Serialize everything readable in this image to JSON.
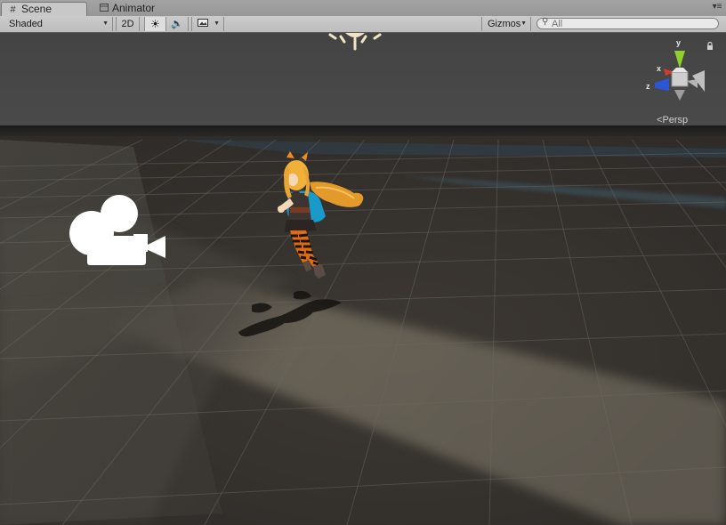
{
  "tabs": [
    {
      "label": "Scene",
      "icon": "grid-icon",
      "active": true
    },
    {
      "label": "Animator",
      "icon": "animator-icon",
      "active": false
    }
  ],
  "toolbar": {
    "shading_mode": "Shaded",
    "mode_2d": "2D",
    "lighting_icon": "sun-icon",
    "audio_icon": "speaker-icon",
    "effects_icon": "image-icon",
    "gizmos": "Gizmos",
    "search_placeholder": "All"
  },
  "gizmo": {
    "x_label": "x",
    "y_label": "y",
    "z_label": "z",
    "projection": "Persp"
  },
  "colors": {
    "x_axis": "#d23a2a",
    "y_axis": "#8fd02c",
    "z_axis": "#2c56d4",
    "ground": "#3a3632",
    "sky": "#474747"
  }
}
